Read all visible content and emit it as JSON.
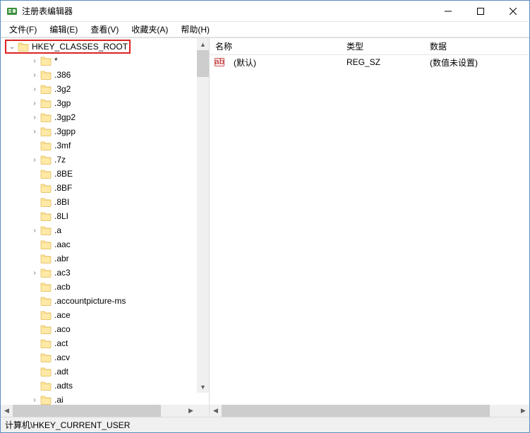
{
  "window": {
    "title": "注册表编辑器"
  },
  "menu": {
    "file": "文件(F)",
    "edit": "编辑(E)",
    "view": "查看(V)",
    "favorites": "收藏夹(A)",
    "help": "帮助(H)"
  },
  "tree": {
    "root": "HKEY_CLASSES_ROOT",
    "items": [
      {
        "label": "*",
        "expandable": true
      },
      {
        "label": ".386",
        "expandable": true
      },
      {
        "label": ".3g2",
        "expandable": true
      },
      {
        "label": ".3gp",
        "expandable": true
      },
      {
        "label": ".3gp2",
        "expandable": true
      },
      {
        "label": ".3gpp",
        "expandable": true
      },
      {
        "label": ".3mf",
        "expandable": false
      },
      {
        "label": ".7z",
        "expandable": true
      },
      {
        "label": ".8BE",
        "expandable": false
      },
      {
        "label": ".8BF",
        "expandable": false
      },
      {
        "label": ".8BI",
        "expandable": false
      },
      {
        "label": ".8LI",
        "expandable": false
      },
      {
        "label": ".a",
        "expandable": true
      },
      {
        "label": ".aac",
        "expandable": false
      },
      {
        "label": ".abr",
        "expandable": false
      },
      {
        "label": ".ac3",
        "expandable": true
      },
      {
        "label": ".acb",
        "expandable": false
      },
      {
        "label": ".accountpicture-ms",
        "expandable": false
      },
      {
        "label": ".ace",
        "expandable": false
      },
      {
        "label": ".aco",
        "expandable": false
      },
      {
        "label": ".act",
        "expandable": false
      },
      {
        "label": ".acv",
        "expandable": false
      },
      {
        "label": ".adt",
        "expandable": false
      },
      {
        "label": ".adts",
        "expandable": false
      },
      {
        "label": ".ai",
        "expandable": true
      }
    ]
  },
  "list": {
    "columns": {
      "name": "名称",
      "type": "类型",
      "data": "数据"
    },
    "rows": [
      {
        "name": "(默认)",
        "type": "REG_SZ",
        "data": "(数值未设置)"
      }
    ]
  },
  "statusbar": {
    "path": "计算机\\HKEY_CURRENT_USER"
  },
  "icons": {
    "app": "regedit-icon",
    "minimize": "minimize-icon",
    "maximize": "maximize-icon",
    "close": "close-icon",
    "folder": "folder-icon",
    "stringvalue": "string-value-icon",
    "chevron_collapsed": "chevron-right-icon",
    "chevron_expanded": "chevron-down-icon"
  }
}
